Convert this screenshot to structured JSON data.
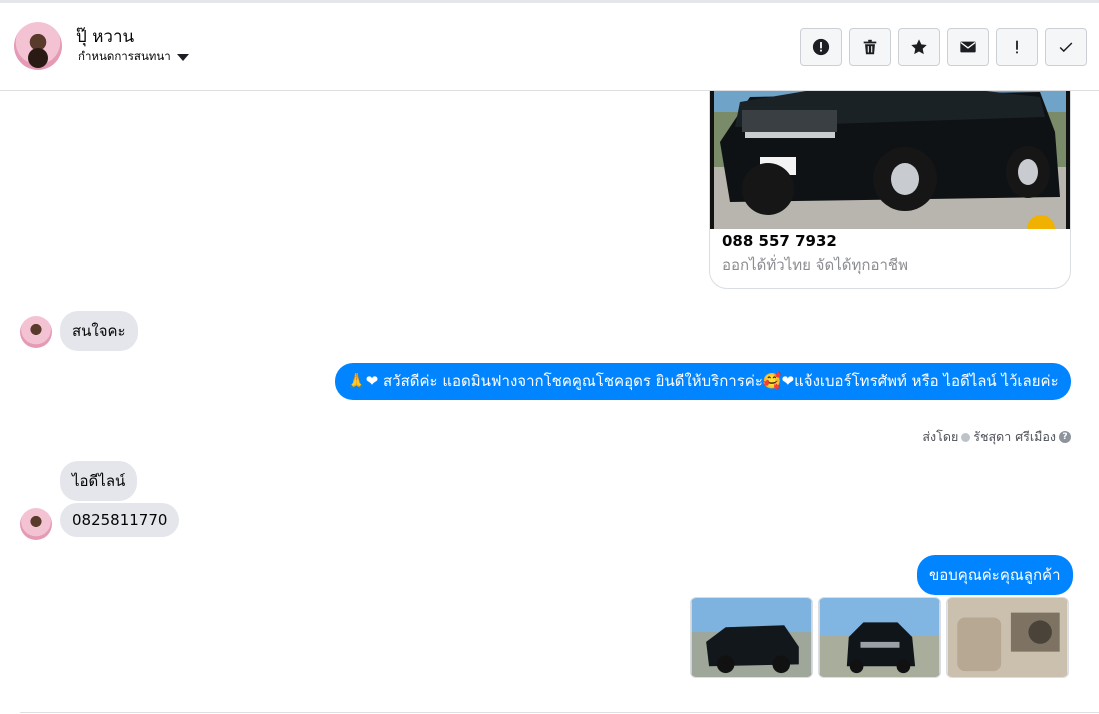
{
  "header": {
    "name": "ปุ๊ หวาน",
    "subtitle": "กำหนดการสนทนา",
    "toolbar": [
      {
        "icon": "alert-circle-icon"
      },
      {
        "icon": "trash-icon"
      },
      {
        "icon": "star-icon"
      },
      {
        "icon": "envelope-icon"
      },
      {
        "icon": "exclamation-icon",
        "label": "!"
      },
      {
        "icon": "checkmark-icon"
      }
    ]
  },
  "messages": {
    "card": {
      "phone": "088 557 7932",
      "description": "ออกได้ทั่วไทย จัดได้ทุกอาชีพ"
    },
    "m1": "สนใจคะ",
    "m2_emoji": "🙏❤",
    "m2": "สวัสดีค่ะ แอดมินฟางจากโชคคูณโชคอุดร ยินดีให้บริการค่ะ🥰❤แจ้งเบอร์โทรศัพท์ หรือ ไอดีไลน์  ไว้เลยค่ะ",
    "sent_by_prefix": "ส่งโดย",
    "sent_by_name": "รัชสุดา ศรีเมือง",
    "m3": "ไอดีไลน์",
    "m4": "0825811770",
    "m5": "ขอบคุณค่ะคุณลูกค้า"
  },
  "colors": {
    "outgoing": "#0084ff",
    "incoming": "#e4e6eb",
    "accent": "#0084ff"
  }
}
